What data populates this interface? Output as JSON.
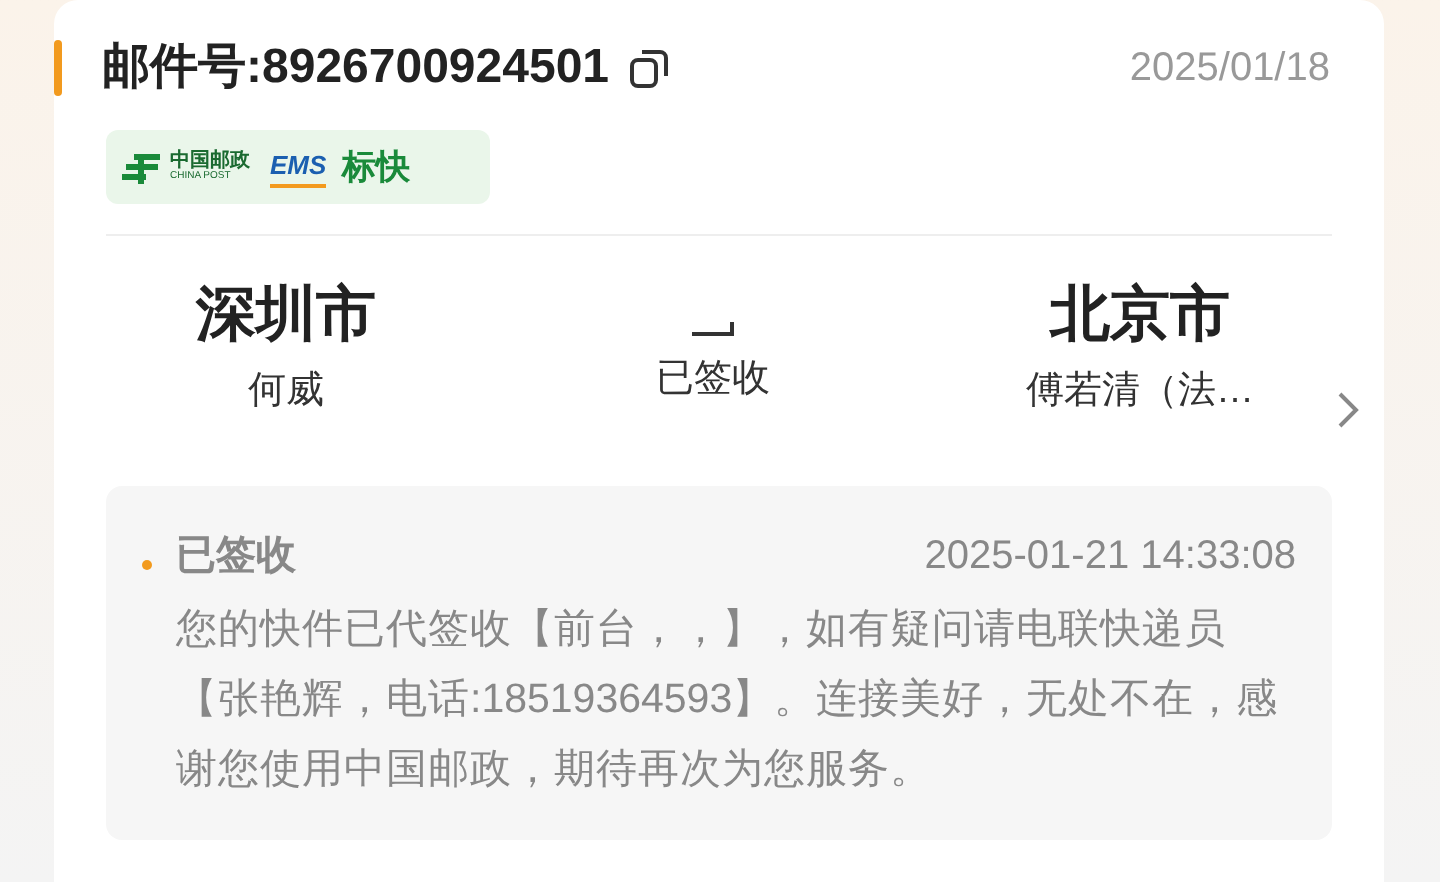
{
  "header": {
    "tracking_number": "邮件号:8926700924501",
    "date": "2025/01/18"
  },
  "carrier_badge": {
    "logo_cn": "中国邮政",
    "logo_en": "CHINA POST",
    "ems": "EMS",
    "service": "标快"
  },
  "route": {
    "origin": {
      "city": "深圳市",
      "person": "何威"
    },
    "status": "已签收",
    "destination": {
      "city": "北京市",
      "person": "傅若清（法…"
    }
  },
  "latest_event": {
    "status": "已签收",
    "time": "2025-01-21 14:33:08",
    "description": "您的快件已代签收【前台，，】，如有疑问请电联快递员【张艳辉，电话:18519364593】。连接美好，无处不在，感谢您使用中国邮政，期待再次为您服务。"
  }
}
